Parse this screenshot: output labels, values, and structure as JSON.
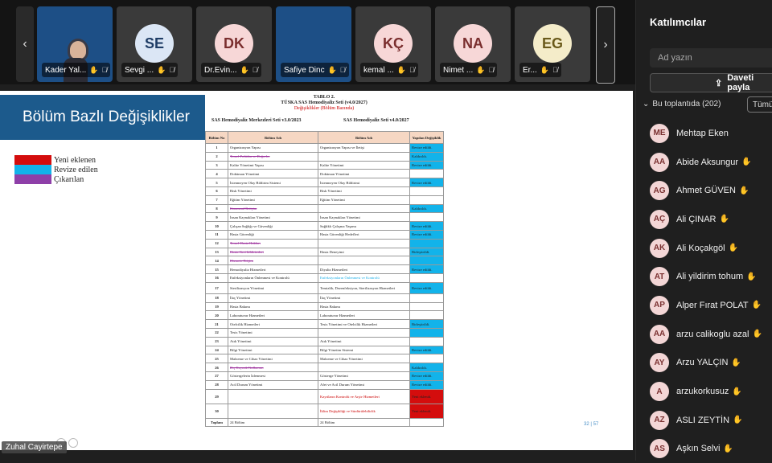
{
  "strip": {
    "tiles": [
      {
        "name": "Kader Yal...",
        "initials": "",
        "blue": true,
        "photo": true
      },
      {
        "name": "Sevgi ...",
        "initials": "SE",
        "bg": "#dbe6f5",
        "fg": "#1f3d66"
      },
      {
        "name": "Dr.Evin...",
        "initials": "DK",
        "bg": "#f7d7d7",
        "fg": "#7a2e2e"
      },
      {
        "name": "Safiye Dinc",
        "initials": "",
        "blue": true
      },
      {
        "name": "kemal ...",
        "initials": "KÇ",
        "bg": "#f7d7d7",
        "fg": "#7a2e2e"
      },
      {
        "name": "Nimet ...",
        "initials": "NA",
        "bg": "#f7d7d7",
        "fg": "#7a2e2e"
      },
      {
        "name": "Er...",
        "initials": "EG",
        "bg": "#f4ecc9",
        "fg": "#6a5a1a"
      }
    ],
    "prev_icon": "chevron-left-icon",
    "next_icon": "chevron-right-icon"
  },
  "slide": {
    "title": "Bölüm Bazlı Değişiklikler",
    "legend": [
      {
        "label": "Yeni eklenen",
        "color": "#d40d0d"
      },
      {
        "label": "Revize edilen",
        "color": "#12b3ea"
      },
      {
        "label": "Çıkarılan",
        "color": "#8e3fa8"
      }
    ],
    "doc_title": "TABLO 2.",
    "doc_subtitle": "TÜSKA SAS Hemodiyaliz Seti (v4.0/2027)",
    "doc_subtitle2": "Değişiklikler (Bölüm Bazında)",
    "set_old": "SAS Hemodiyaliz Merkezleri Seti v3.0/2023",
    "set_new": "SAS Hemodiyaliz Seti v4.0/2027",
    "headers": [
      "Bölüm No",
      "Bölüm Adı",
      "Bölüm Adı",
      "Yapılan Değişiklik"
    ],
    "rows": [
      {
        "no": "1",
        "old": "Organizasyon Yapısı",
        "new": "Organizasyon Yapısı ve İletişi",
        "change": "Revize edildi.",
        "type": "rev"
      },
      {
        "no": "2",
        "old": "Temel Politika ve Değerler",
        "new": "",
        "change": "Kaldırıldı.",
        "type": "rev",
        "olddel": true
      },
      {
        "no": "3",
        "old": "Kalite Yönetimi Yapısı",
        "new": "Kalite Yönetimi",
        "change": "Revize edildi.",
        "type": "rev"
      },
      {
        "no": "4",
        "old": "Doküman Yönetimi",
        "new": "Doküman Yönetimi",
        "change": "",
        "type": ""
      },
      {
        "no": "5",
        "old": "İstenmeyen Olay Bildirim Sistemi",
        "new": "İstenmeyen Olay Bildirimi",
        "change": "Revize edildi.",
        "type": "rev"
      },
      {
        "no": "6",
        "old": "Risk Yönetimi",
        "new": "Risk Yönetimi",
        "change": "",
        "type": ""
      },
      {
        "no": "7",
        "old": "Eğitim Yönetimi",
        "new": "Eğitim Yönetimi",
        "change": "",
        "type": ""
      },
      {
        "no": "8",
        "old": "Kurumsal İletişim",
        "new": "",
        "change": "Kaldırıldı.",
        "type": "rev",
        "olddel": true
      },
      {
        "no": "9",
        "old": "İnsan Kaynakları Yönetimi",
        "new": "İnsan Kaynakları Yönetimi",
        "change": "",
        "type": ""
      },
      {
        "no": "10",
        "old": "Çalışan Sağlığı ve Güvenliği",
        "new": "Sağlıklı Çalışma Yaşamı",
        "change": "Revize edildi.",
        "type": "rev"
      },
      {
        "no": "11",
        "old": "Hasta Güvenliği",
        "new": "Hasta Güvenliği Hedefleri",
        "change": "Revize edildi.",
        "type": "rev"
      },
      {
        "no": "12",
        "old": "Temel Hasta Hakları",
        "new": "",
        "change": "",
        "type": "rev",
        "olddel": true
      },
      {
        "no": "13",
        "old": "Hasta Geri bildirimleri",
        "new": "Hasta Deneyimi",
        "change": "Birleştirildi.",
        "type": "rev",
        "olddel": true
      },
      {
        "no": "14",
        "old": "Hizmete Erişim",
        "new": "",
        "change": "",
        "type": "rev",
        "olddel": true
      },
      {
        "no": "15",
        "old": "Hemodiyaliz Hizmetleri",
        "new": "Diyaliz Hizmetleri",
        "change": "Revize edildi.",
        "type": "rev"
      },
      {
        "no": "16",
        "old": "Enfeksiyonların Önlenmesi ve Kontrolü",
        "new": "Enfeksiyonların Önlenmesi ve Kontrolü",
        "change": "",
        "type": "",
        "newrev": true
      },
      {
        "no": "17",
        "old": "Sterilizasyon Yönetimi",
        "new": "Temizlik, Dezenfeksiyon, Sterilizasyon Hizmetleri",
        "change": "Revize edildi.",
        "type": "rev"
      },
      {
        "no": "18",
        "old": "İlaç Yönetimi",
        "new": "İlaç Yönetimi",
        "change": "",
        "type": ""
      },
      {
        "no": "19",
        "old": "Hasta Bakımı",
        "new": "Hasta Bakımı",
        "change": "",
        "type": ""
      },
      {
        "no": "20",
        "old": "Laboratuvar Hizmetleri",
        "new": "Laboratuvar Hizmetleri",
        "change": "",
        "type": ""
      },
      {
        "no": "21",
        "old": "Otelcilik Hizmetleri",
        "new": "Tesis Yönetimi ve Otelcilik Hizmetleri",
        "change": "Birleştirildi.",
        "type": "rev"
      },
      {
        "no": "22",
        "old": "Tesis Yönetimi",
        "new": "",
        "change": "",
        "type": "rev"
      },
      {
        "no": "23",
        "old": "Atık Yönetimi",
        "new": "Atık Yönetimi",
        "change": "",
        "type": ""
      },
      {
        "no": "24",
        "old": "Bilgi Yönetimi",
        "new": "Bilgi Yönetim Sistemi",
        "change": "Revize edildi.",
        "type": "rev"
      },
      {
        "no": "25",
        "old": "Malzeme ve Cihaz Yönetimi",
        "new": "Malzeme ve Cihaz Yönetimi",
        "change": "",
        "type": ""
      },
      {
        "no": "26",
        "old": "Dış Kaynak Kullanımı",
        "new": "",
        "change": "Kaldırıldı.",
        "type": "rev",
        "olddel": true
      },
      {
        "no": "27",
        "old": "Göstergelerin İzlenmesi",
        "new": "Gösterge Yönetimi",
        "change": "Revize edildi.",
        "type": "rev"
      },
      {
        "no": "28",
        "old": "Acil Durum Yönetimi",
        "new": "Afet ve Acil Durum Yönetimi",
        "change": "Revize edildi.",
        "type": "rev"
      },
      {
        "no": "29",
        "old": "",
        "new": "Kayıtların Kontrolü ve Arşiv Hizmetleri",
        "change": "Yeni eklendi.",
        "type": "new"
      },
      {
        "no": "30",
        "old": "",
        "new": "İklim Değişikliği ve Sürdürülebilirlik",
        "change": "Yeni eklendi.",
        "type": "new"
      }
    ],
    "total_label": "Toplam",
    "total_old": "24 Bölüm",
    "total_new": "24 Bölüm",
    "page_num": "32 | 57"
  },
  "presenter": "Zuhal Cayirtepe",
  "panel": {
    "title": "Katılımcılar",
    "search_placeholder": "Ad yazın",
    "invite_label": "Daveti payla",
    "meeting_label": "Bu toplantıda (202)",
    "all_label": "Tümü",
    "participants": [
      {
        "initials": "ME",
        "name": "Mehtap Eken",
        "hand": false
      },
      {
        "initials": "AA",
        "name": "Abide Aksungur",
        "hand": true
      },
      {
        "initials": "AG",
        "name": "Ahmet GÜVEN",
        "hand": true
      },
      {
        "initials": "AÇ",
        "name": "Ali ÇINAR",
        "hand": true
      },
      {
        "initials": "AK",
        "name": "Ali Koçakgöl",
        "hand": true
      },
      {
        "initials": "AT",
        "name": "Ali yildirim tohum",
        "hand": true
      },
      {
        "initials": "AP",
        "name": "Alper Fırat POLAT",
        "hand": true
      },
      {
        "initials": "AA",
        "name": "arzu calikoglu azal",
        "hand": true
      },
      {
        "initials": "AY",
        "name": "Arzu YALÇIN",
        "hand": true
      },
      {
        "initials": "A",
        "name": "arzukorkusuz",
        "hand": true
      },
      {
        "initials": "AZ",
        "name": "ASLI ZEYTİN",
        "hand": true
      },
      {
        "initials": "AS",
        "name": "Aşkın Selvi",
        "hand": true
      }
    ]
  }
}
